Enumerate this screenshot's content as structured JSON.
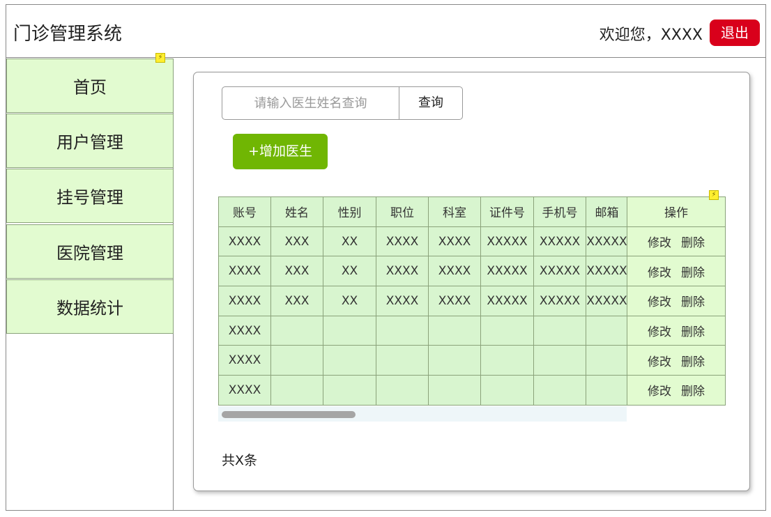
{
  "header": {
    "title": "门诊管理系统",
    "welcome": "欢迎您，XXXX",
    "logout_label": "退出"
  },
  "sidebar": {
    "items": [
      {
        "label": "首页"
      },
      {
        "label": "用户管理"
      },
      {
        "label": "挂号管理"
      },
      {
        "label": "医院管理"
      },
      {
        "label": "数据统计"
      }
    ]
  },
  "main": {
    "search": {
      "placeholder": "请输入医生姓名查询",
      "value": "",
      "button_label": "查询"
    },
    "add_button_label": "+增加医生",
    "table": {
      "columns": [
        "账号",
        "姓名",
        "性别",
        "职位",
        "科室",
        "证件号",
        "手机号",
        "邮箱"
      ],
      "ops_header": "操作",
      "rows": [
        [
          "XXXX",
          "XXX",
          "XX",
          "XXXX",
          "XXXX",
          "XXXXX",
          "XXXXX",
          "XXXXX"
        ],
        [
          "XXXX",
          "XXX",
          "XX",
          "XXXX",
          "XXXX",
          "XXXXX",
          "XXXXX",
          "XXXXX"
        ],
        [
          "XXXX",
          "XXX",
          "XX",
          "XXXX",
          "XXXX",
          "XXXXX",
          "XXXXX",
          "XXXXX"
        ],
        [
          "XXXX",
          "",
          "",
          "",
          "",
          "",
          "",
          ""
        ],
        [
          "XXXX",
          "",
          "",
          "",
          "",
          "",
          "",
          ""
        ],
        [
          "XXXX",
          "",
          "",
          "",
          "",
          "",
          "",
          ""
        ]
      ],
      "edit_label": "修改",
      "delete_label": "删除"
    },
    "total_text": "共X条"
  },
  "icons": {
    "interaction_marker": "lightning-bolt-icon"
  },
  "colors": {
    "logout": "#d9001b",
    "add_button": "#70b603",
    "sidebar_bg": "#e2fbd0",
    "table_bg": "#d8f5cf",
    "marker": "#ffef30"
  }
}
